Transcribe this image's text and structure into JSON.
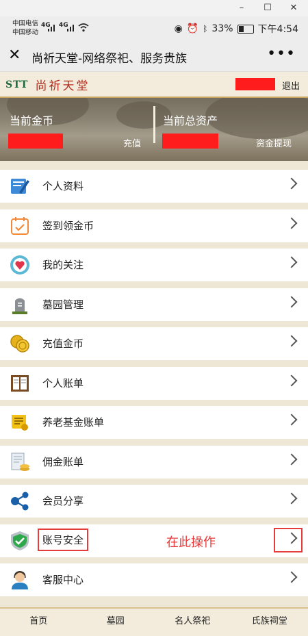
{
  "status": {
    "carrier1": "中国电信",
    "carrier2": "中国移动",
    "net1": "4G",
    "net2": "4G",
    "battery": "33%",
    "time": "下午4:54"
  },
  "appbar": {
    "title": "尚祈天堂-网络祭祀、服务贵族"
  },
  "site": {
    "brand": "STT",
    "name": "尚祈天堂",
    "logout": "退出"
  },
  "banner": {
    "coins_label": "当前金币",
    "recharge": "充值",
    "assets_label": "当前总资产",
    "withdraw": "资金提现"
  },
  "menu": [
    {
      "label": "个人资料",
      "icon": "profile-pen-icon"
    },
    {
      "label": "签到领金币",
      "icon": "calendar-check-icon"
    },
    {
      "label": "我的关注",
      "icon": "heart-icon"
    },
    {
      "label": "墓园管理",
      "icon": "tombstone-icon"
    },
    {
      "label": "充值金币",
      "icon": "coins-icon"
    },
    {
      "label": "个人账单",
      "icon": "ledger-book-icon"
    },
    {
      "label": "养老基金账单",
      "icon": "certificate-icon"
    },
    {
      "label": "佣金账单",
      "icon": "document-coins-icon"
    },
    {
      "label": "会员分享",
      "icon": "share-icon"
    },
    {
      "label": "账号安全",
      "icon": "shield-check-icon"
    },
    {
      "label": "客服中心",
      "icon": "support-agent-icon"
    }
  ],
  "annotation": {
    "text": "在此操作"
  },
  "bottom_nav": [
    "首页",
    "墓园",
    "名人祭祀",
    "氏族祠堂"
  ],
  "colors": {
    "annotation_red": "#e53b3b",
    "redacted": "#ff1c1c",
    "gold_border": "#c9a65f"
  }
}
